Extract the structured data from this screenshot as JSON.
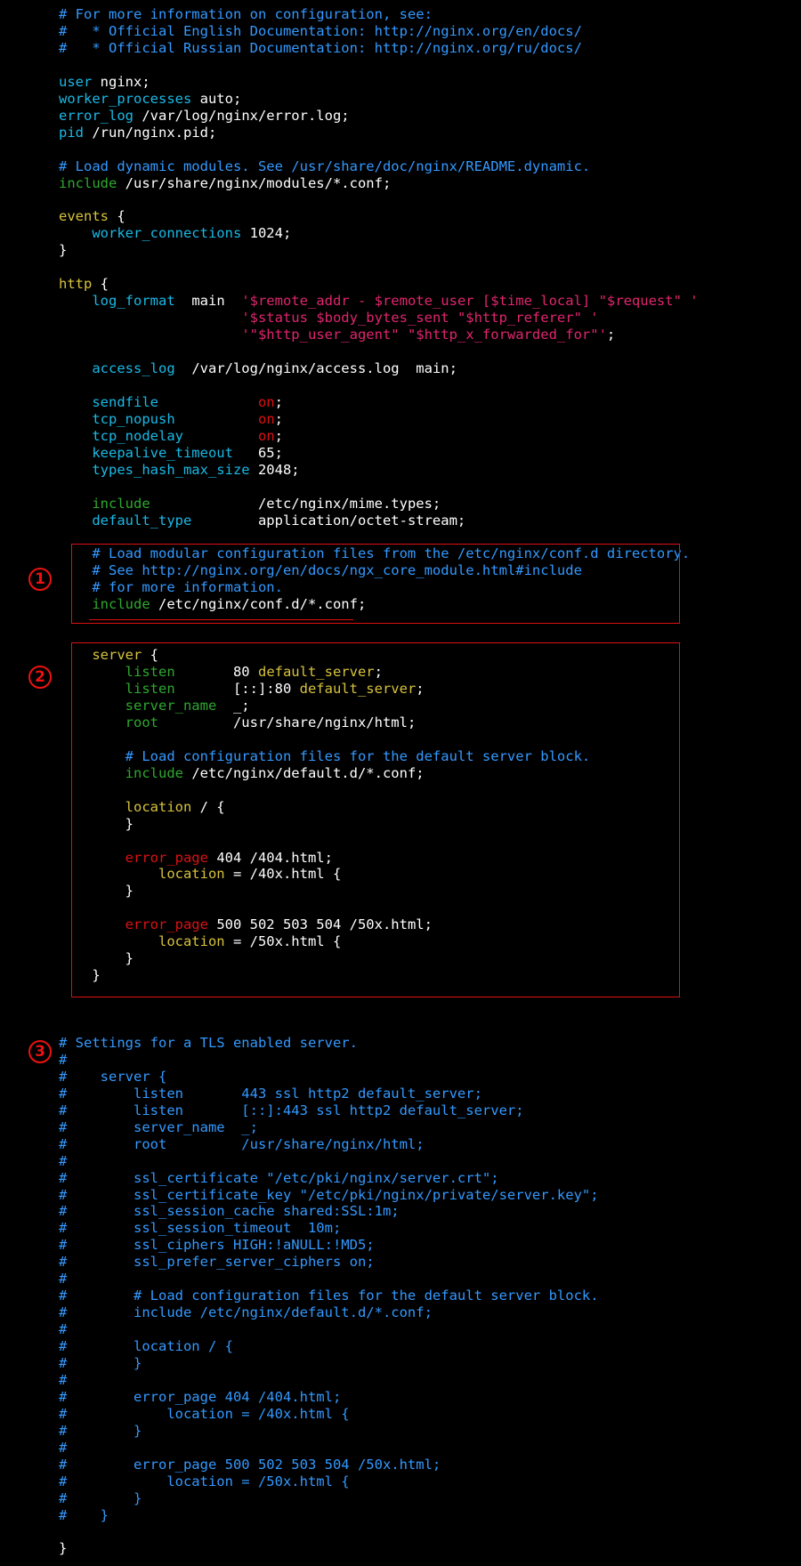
{
  "app": {
    "name": "nginx.conf terminal view"
  },
  "colors": {
    "background": "#000000",
    "text": "#ffffff",
    "comment": "#3399ff",
    "keyword": "#19b9e6",
    "block": "#d7c23c",
    "include": "#2ea82e",
    "string": "#e1256e",
    "value_on": "#dd1111",
    "highlight_box": "#dd1111"
  },
  "annotations": [
    {
      "label": "①",
      "box": "include-conf-d-section"
    },
    {
      "label": "②",
      "box": "default-server-block"
    },
    {
      "label": "③",
      "box": "tls-server-comment-block"
    }
  ],
  "lines": [
    [
      [
        "cmt",
        "# For more information on configuration, see:"
      ]
    ],
    [
      [
        "cmt",
        "#   * Official English Documentation: http://nginx.org/en/docs/"
      ]
    ],
    [
      [
        "cmt",
        "#   * Official Russian Documentation: http://nginx.org/ru/docs/"
      ]
    ],
    [],
    [
      [
        "kw",
        "user"
      ],
      [
        "plain",
        " nginx;"
      ]
    ],
    [
      [
        "kw",
        "worker_processes"
      ],
      [
        "plain",
        " auto;"
      ]
    ],
    [
      [
        "kw",
        "error_log"
      ],
      [
        "plain",
        " /var/log/nginx/error.log;"
      ]
    ],
    [
      [
        "kw",
        "pid"
      ],
      [
        "plain",
        " /run/nginx.pid;"
      ]
    ],
    [],
    [
      [
        "cmt",
        "# Load dynamic modules. See /usr/share/doc/nginx/README.dynamic."
      ]
    ],
    [
      [
        "inc",
        "include"
      ],
      [
        "plain",
        " /usr/share/nginx/modules/*.conf;"
      ]
    ],
    [],
    [
      [
        "blk",
        "events"
      ],
      [
        "plain",
        " {"
      ]
    ],
    [
      [
        "plain",
        "    "
      ],
      [
        "kw",
        "worker_connections"
      ],
      [
        "plain",
        " 1024;"
      ]
    ],
    [
      [
        "plain",
        "}"
      ]
    ],
    [],
    [
      [
        "blk",
        "http"
      ],
      [
        "plain",
        " {"
      ]
    ],
    [
      [
        "plain",
        "    "
      ],
      [
        "kw",
        "log_format"
      ],
      [
        "plain",
        "  main  "
      ],
      [
        "str",
        "'$remote_addr - $remote_user [$time_local] \"$request\" '"
      ]
    ],
    [
      [
        "plain",
        "                      "
      ],
      [
        "str",
        "'$status $body_bytes_sent \"$http_referer\" '"
      ]
    ],
    [
      [
        "plain",
        "                      "
      ],
      [
        "str",
        "'\"$http_user_agent\" \"$http_x_forwarded_for\"'"
      ],
      [
        "plain",
        ";"
      ]
    ],
    [],
    [
      [
        "plain",
        "    "
      ],
      [
        "kw",
        "access_log"
      ],
      [
        "plain",
        "  /var/log/nginx/access.log  main;"
      ]
    ],
    [],
    [
      [
        "plain",
        "    "
      ],
      [
        "kw",
        "sendfile"
      ],
      [
        "plain",
        "            "
      ],
      [
        "on",
        "on"
      ],
      [
        "plain",
        ";"
      ]
    ],
    [
      [
        "plain",
        "    "
      ],
      [
        "kw",
        "tcp_nopush"
      ],
      [
        "plain",
        "          "
      ],
      [
        "on",
        "on"
      ],
      [
        "plain",
        ";"
      ]
    ],
    [
      [
        "plain",
        "    "
      ],
      [
        "kw",
        "tcp_nodelay"
      ],
      [
        "plain",
        "         "
      ],
      [
        "on",
        "on"
      ],
      [
        "plain",
        ";"
      ]
    ],
    [
      [
        "plain",
        "    "
      ],
      [
        "kw",
        "keepalive_timeout"
      ],
      [
        "plain",
        "   65;"
      ]
    ],
    [
      [
        "plain",
        "    "
      ],
      [
        "kw",
        "types_hash_max_size"
      ],
      [
        "plain",
        " 2048;"
      ]
    ],
    [],
    [
      [
        "plain",
        "    "
      ],
      [
        "inc",
        "include"
      ],
      [
        "plain",
        "             /etc/nginx/mime.types;"
      ]
    ],
    [
      [
        "plain",
        "    "
      ],
      [
        "kw",
        "default_type"
      ],
      [
        "plain",
        "        application/octet-stream;"
      ]
    ],
    [],
    [
      [
        "plain",
        "    "
      ],
      [
        "cmt",
        "# Load modular configuration files from the /etc/nginx/conf.d directory."
      ]
    ],
    [
      [
        "plain",
        "    "
      ],
      [
        "cmt",
        "# See http://nginx.org/en/docs/ngx_core_module.html#include"
      ]
    ],
    [
      [
        "plain",
        "    "
      ],
      [
        "cmt",
        "# for more information."
      ]
    ],
    [
      [
        "plain",
        "    "
      ],
      [
        "inc",
        "include"
      ],
      [
        "plain",
        " /etc/nginx/conf.d/*.conf;"
      ]
    ],
    [],
    [],
    [
      [
        "plain",
        "    "
      ],
      [
        "blk",
        "server"
      ],
      [
        "plain",
        " {"
      ]
    ],
    [
      [
        "plain",
        "        "
      ],
      [
        "inc",
        "listen"
      ],
      [
        "plain",
        "       80 "
      ],
      [
        "blk",
        "default_server"
      ],
      [
        "plain",
        ";"
      ]
    ],
    [
      [
        "plain",
        "        "
      ],
      [
        "inc",
        "listen"
      ],
      [
        "plain",
        "       [::]:80 "
      ],
      [
        "blk",
        "default_server"
      ],
      [
        "plain",
        ";"
      ]
    ],
    [
      [
        "plain",
        "        "
      ],
      [
        "inc",
        "server_name"
      ],
      [
        "plain",
        "  _;"
      ]
    ],
    [
      [
        "plain",
        "        "
      ],
      [
        "inc",
        "root"
      ],
      [
        "plain",
        "         /usr/share/nginx/html;"
      ]
    ],
    [],
    [
      [
        "plain",
        "        "
      ],
      [
        "cmt",
        "# Load configuration files for the default server block."
      ]
    ],
    [
      [
        "plain",
        "        "
      ],
      [
        "inc",
        "include"
      ],
      [
        "plain",
        " /etc/nginx/default.d/*.conf;"
      ]
    ],
    [],
    [
      [
        "plain",
        "        "
      ],
      [
        "blk",
        "location"
      ],
      [
        "plain",
        " / {"
      ]
    ],
    [
      [
        "plain",
        "        }"
      ]
    ],
    [],
    [
      [
        "plain",
        "        "
      ],
      [
        "on",
        "error_page"
      ],
      [
        "plain",
        " 404 /404.html;"
      ]
    ],
    [
      [
        "plain",
        "            "
      ],
      [
        "blk",
        "location"
      ],
      [
        "plain",
        " = /40x.html {"
      ]
    ],
    [
      [
        "plain",
        "        }"
      ]
    ],
    [],
    [
      [
        "plain",
        "        "
      ],
      [
        "on",
        "error_page"
      ],
      [
        "plain",
        " 500 502 503 504 /50x.html;"
      ]
    ],
    [
      [
        "plain",
        "            "
      ],
      [
        "blk",
        "location"
      ],
      [
        "plain",
        " = /50x.html {"
      ]
    ],
    [
      [
        "plain",
        "        }"
      ]
    ],
    [
      [
        "plain",
        "    }"
      ]
    ],
    [],
    [],
    [],
    [
      [
        "cmt",
        "# Settings for a TLS enabled server."
      ]
    ],
    [
      [
        "cmt",
        "#"
      ]
    ],
    [
      [
        "cmt",
        "#    server {"
      ]
    ],
    [
      [
        "cmt",
        "#        listen       443 ssl http2 default_server;"
      ]
    ],
    [
      [
        "cmt",
        "#        listen       [::]:443 ssl http2 default_server;"
      ]
    ],
    [
      [
        "cmt",
        "#        server_name  _;"
      ]
    ],
    [
      [
        "cmt",
        "#        root         /usr/share/nginx/html;"
      ]
    ],
    [
      [
        "cmt",
        "#"
      ]
    ],
    [
      [
        "cmt",
        "#        ssl_certificate \"/etc/pki/nginx/server.crt\";"
      ]
    ],
    [
      [
        "cmt",
        "#        ssl_certificate_key \"/etc/pki/nginx/private/server.key\";"
      ]
    ],
    [
      [
        "cmt",
        "#        ssl_session_cache shared:SSL:1m;"
      ]
    ],
    [
      [
        "cmt",
        "#        ssl_session_timeout  10m;"
      ]
    ],
    [
      [
        "cmt",
        "#        ssl_ciphers HIGH:!aNULL:!MD5;"
      ]
    ],
    [
      [
        "cmt",
        "#        ssl_prefer_server_ciphers on;"
      ]
    ],
    [
      [
        "cmt",
        "#"
      ]
    ],
    [
      [
        "cmt",
        "#        # Load configuration files for the default server block."
      ]
    ],
    [
      [
        "cmt",
        "#        include /etc/nginx/default.d/*.conf;"
      ]
    ],
    [
      [
        "cmt",
        "#"
      ]
    ],
    [
      [
        "cmt",
        "#        location / {"
      ]
    ],
    [
      [
        "cmt",
        "#        }"
      ]
    ],
    [
      [
        "cmt",
        "#"
      ]
    ],
    [
      [
        "cmt",
        "#        error_page 404 /404.html;"
      ]
    ],
    [
      [
        "cmt",
        "#            location = /40x.html {"
      ]
    ],
    [
      [
        "cmt",
        "#        }"
      ]
    ],
    [
      [
        "cmt",
        "#"
      ]
    ],
    [
      [
        "cmt",
        "#        error_page 500 502 503 504 /50x.html;"
      ]
    ],
    [
      [
        "cmt",
        "#            location = /50x.html {"
      ]
    ],
    [
      [
        "cmt",
        "#        }"
      ]
    ],
    [
      [
        "cmt",
        "#    }"
      ]
    ],
    [],
    [
      [
        "plain",
        "}"
      ]
    ]
  ]
}
